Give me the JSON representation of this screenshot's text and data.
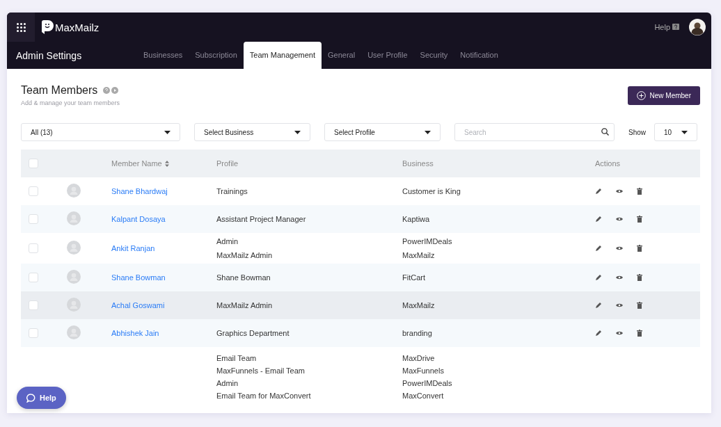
{
  "app": {
    "brand": "MaxMailz",
    "help": "Help",
    "section": "Admin Settings"
  },
  "tabs": [
    {
      "label": "Businesses",
      "selected": false
    },
    {
      "label": "Subscription",
      "selected": false
    },
    {
      "label": "Team Management",
      "selected": true
    },
    {
      "label": "General",
      "selected": false
    },
    {
      "label": "User Profile",
      "selected": false
    },
    {
      "label": "Security",
      "selected": false
    },
    {
      "label": "Notification",
      "selected": false
    }
  ],
  "page": {
    "title": "Team Members",
    "subtitle": "Add & manage your team members",
    "new_button": "New Member"
  },
  "filters": {
    "status": "All (13)",
    "business": "Select Business",
    "profile": "Select Profile",
    "search_placeholder": "Search",
    "show_label": "Show",
    "show_value": "10"
  },
  "table": {
    "all_checked": false,
    "columns": [
      "Member Name",
      "Profile",
      "Business",
      "Actions"
    ],
    "rows": [
      {
        "kind": "member",
        "checked": false,
        "highlighted": false,
        "name": "Shane Bhardwaj",
        "profiles": [
          "Trainings"
        ],
        "businesses": [
          "Customer is King"
        ]
      },
      {
        "kind": "member",
        "checked": false,
        "highlighted": false,
        "name": "Kalpant Dosaya",
        "profiles": [
          "Assistant Project Manager"
        ],
        "businesses": [
          "Kaptiwa"
        ]
      },
      {
        "kind": "member",
        "checked": false,
        "highlighted": false,
        "name": "Ankit Ranjan",
        "profiles": [
          "Admin",
          "MaxMailz Admin"
        ],
        "businesses": [
          "PowerIMDeals",
          "MaxMailz"
        ]
      },
      {
        "kind": "member",
        "checked": false,
        "highlighted": false,
        "name": "Shane Bowman",
        "profiles": [
          "Shane Bowman"
        ],
        "businesses": [
          "FitCart"
        ]
      },
      {
        "kind": "member",
        "checked": false,
        "highlighted": true,
        "name": "Achal Goswami",
        "profiles": [
          "MaxMailz Admin"
        ],
        "businesses": [
          "MaxMailz"
        ]
      },
      {
        "kind": "member",
        "checked": false,
        "highlighted": false,
        "name": "Abhishek Jain",
        "profiles": [
          "Graphics Department"
        ],
        "businesses": [
          "branding"
        ]
      },
      {
        "kind": "cut",
        "profiles": [
          "Email Team",
          "MaxFunnels - Email Team",
          "Admin",
          "Email Team for MaxConvert"
        ],
        "businesses": [
          "MaxDrive",
          "MaxFunnels",
          "PowerIMDeals",
          "MaxConvert"
        ]
      }
    ]
  },
  "chat_button": "Help"
}
